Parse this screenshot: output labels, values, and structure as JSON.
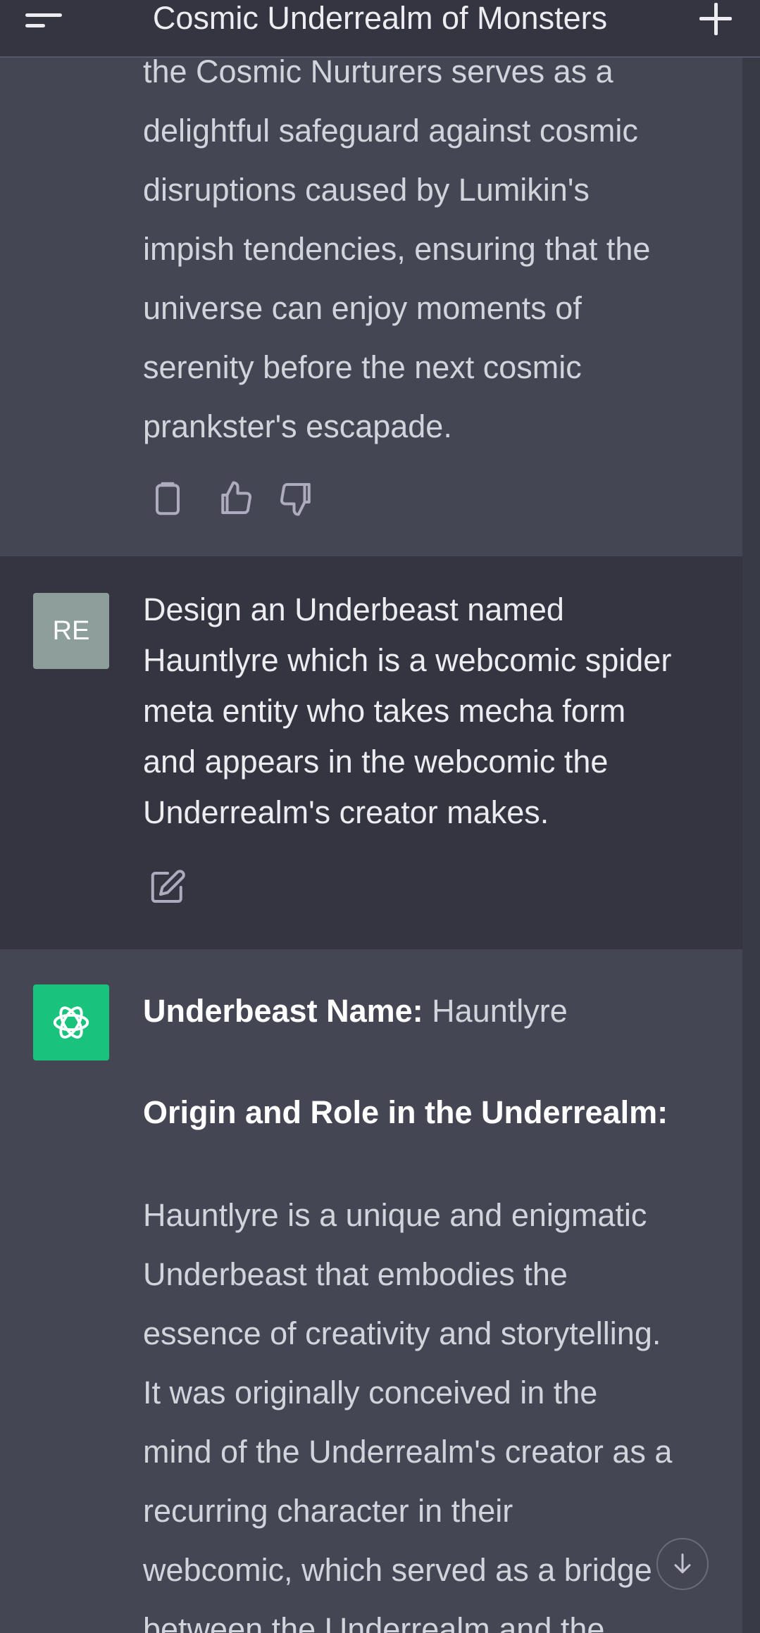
{
  "header": {
    "title": "Cosmic Underrealm of Monsters"
  },
  "messages": {
    "prev_assistant": {
      "lines": [
        "the Cosmic Nurturers serves as a",
        "delightful safeguard against cosmic",
        "disruptions caused by Lumikin's",
        "impish tendencies, ensuring that the",
        "universe can enjoy moments of",
        "serenity before the next cosmic",
        "prankster's escapade."
      ]
    },
    "user": {
      "avatar_initials": "RE",
      "lines": [
        "Design an Underbeast named",
        "Hauntlyre which is a webcomic spider",
        "meta entity who takes mecha form",
        "and appears in the webcomic the",
        "Underrealm's creator makes."
      ]
    },
    "assistant": {
      "name_label": "Underbeast Name:",
      "name_value": "Hauntlyre",
      "section_heading": "Origin and Role in the Underrealm:",
      "lines": [
        "Hauntlyre is a unique and enigmatic",
        "Underbeast that embodies the",
        "essence of creativity and storytelling.",
        "It was originally conceived in the",
        "mind of the Underrealm's creator as a",
        "recurring character in their",
        "webcomic, which served as a bridge",
        "between the Underrealm and the"
      ]
    }
  },
  "icons": {
    "copy": "clipboard-icon",
    "like": "thumbs-up-icon",
    "dislike": "thumbs-down-icon",
    "edit": "edit-icon",
    "bot": "openai-logo-icon",
    "scroll": "arrow-down-icon"
  },
  "colors": {
    "header_bg": "#343541",
    "assistant_bg": "#444654",
    "user_bg": "#343541",
    "bot_avatar": "#19c37d",
    "user_avatar": "#8e9e9b"
  }
}
